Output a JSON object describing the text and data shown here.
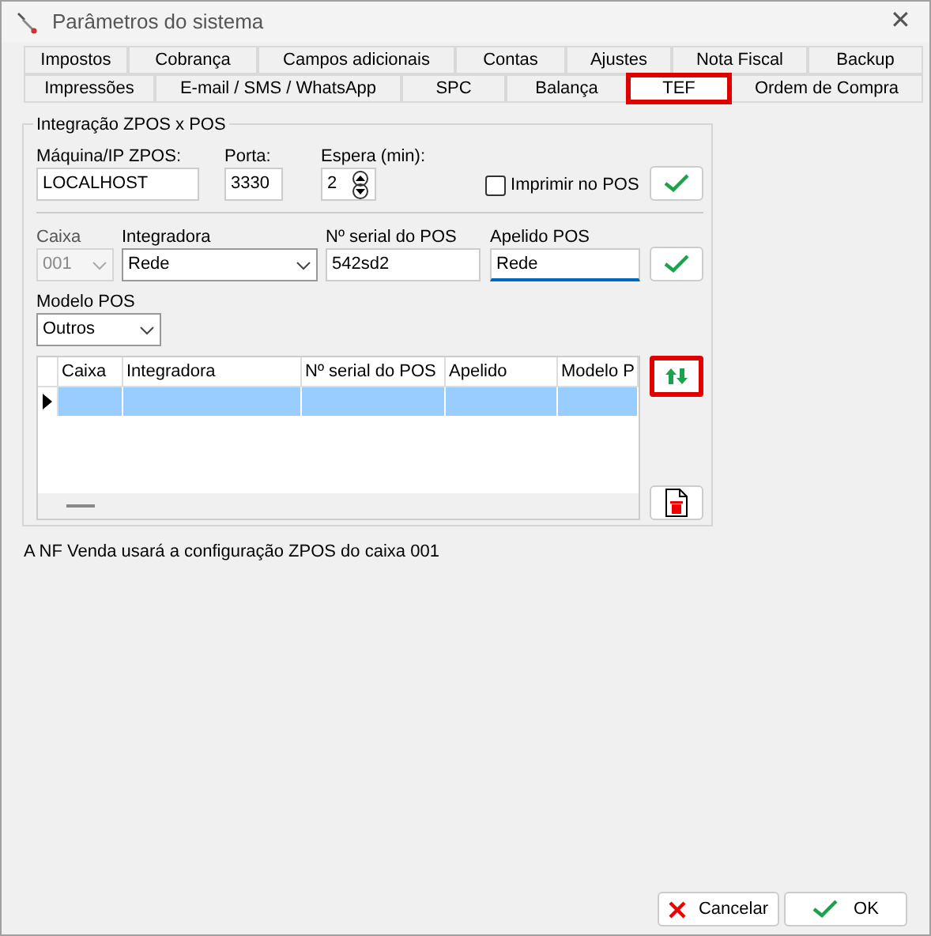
{
  "window": {
    "title": "Parâmetros do sistema",
    "close": "✕"
  },
  "tab_rows": [
    [
      {
        "label": "Impostos",
        "selected": false,
        "highlighted": false
      },
      {
        "label": "Cobrança",
        "selected": false,
        "highlighted": false
      },
      {
        "label": "Campos adicionais",
        "selected": false,
        "highlighted": false
      },
      {
        "label": "Contas",
        "selected": false,
        "highlighted": false
      },
      {
        "label": "Ajustes",
        "selected": false,
        "highlighted": false
      },
      {
        "label": "Nota Fiscal",
        "selected": false,
        "highlighted": false
      },
      {
        "label": "Backup",
        "selected": false,
        "highlighted": false
      }
    ],
    [
      {
        "label": "Impressões",
        "selected": false,
        "highlighted": false
      },
      {
        "label": "E-mail / SMS / WhatsApp",
        "selected": false,
        "highlighted": false
      },
      {
        "label": "SPC",
        "selected": false,
        "highlighted": false
      },
      {
        "label": "Balança",
        "selected": false,
        "highlighted": false
      },
      {
        "label": "TEF",
        "selected": true,
        "highlighted": true
      },
      {
        "label": "Ordem de Compra",
        "selected": false,
        "highlighted": false
      }
    ]
  ],
  "group": {
    "title": "Integração ZPOS x POS",
    "server": {
      "machine": {
        "label": "Máquina/IP ZPOS:",
        "value": "LOCALHOST"
      },
      "port": {
        "label": "Porta:",
        "value": "3330"
      },
      "wait": {
        "label": "Espera (min):",
        "value": "2"
      },
      "print_on_pos": {
        "label": "Imprimir no POS",
        "checked": false
      },
      "confirm_highlighted": false
    },
    "pos": {
      "register": {
        "label": "Caixa",
        "value": "001",
        "disabled": true
      },
      "integrator": {
        "label": "Integradora",
        "value": "Rede"
      },
      "serial": {
        "label": "Nº serial do POS",
        "value": "542sd2"
      },
      "nickname": {
        "label": "Apelido POS",
        "value": "Rede",
        "focused": true
      },
      "model": {
        "label": "Modelo POS",
        "value": "Outros"
      },
      "confirm_highlighted": false
    },
    "grid": {
      "columns": [
        "Caixa",
        "Integradora",
        "Nº serial do POS",
        "Apelido",
        "Modelo P"
      ],
      "rows": [
        {
          "selected": true
        }
      ]
    },
    "swap_highlighted": true
  },
  "status_text": "A NF Venda usará a configuração ZPOS do caixa 001",
  "buttons": [
    {
      "kind": "cancel",
      "label": "Cancelar"
    },
    {
      "kind": "ok",
      "label": "OK"
    }
  ]
}
